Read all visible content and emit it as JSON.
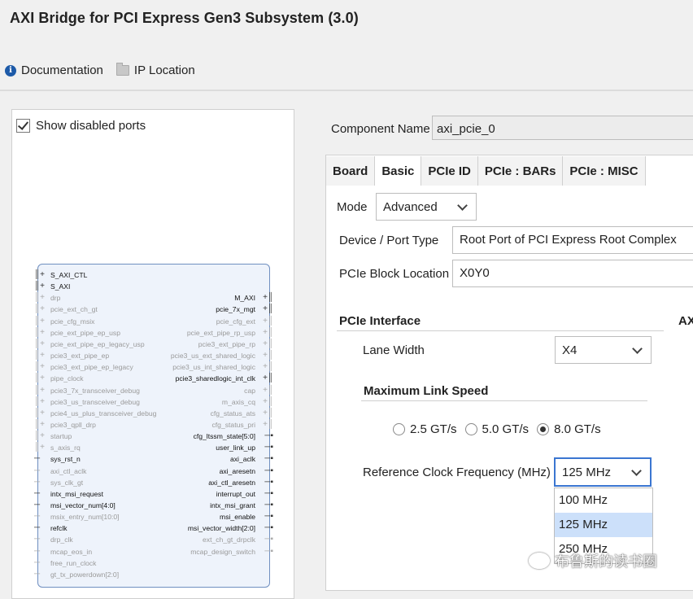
{
  "window": {
    "title": "AXI Bridge for PCI Express Gen3 Subsystem (3.0)"
  },
  "toolbar": {
    "documentation": "Documentation",
    "ip_location": "IP Location"
  },
  "left": {
    "show_disabled_ports": "Show disabled ports"
  },
  "block": {
    "left_ports": [
      {
        "label": "S_AXI_CTL",
        "enabled": true,
        "pin": "+"
      },
      {
        "label": "S_AXI",
        "enabled": true,
        "pin": "+"
      },
      {
        "label": "drp",
        "enabled": false,
        "pin": "+"
      },
      {
        "label": "pcie_ext_ch_gt",
        "enabled": false,
        "pin": "+"
      },
      {
        "label": "pcie_cfg_msix",
        "enabled": false,
        "pin": "+"
      },
      {
        "label": "pcie_ext_pipe_ep_usp",
        "enabled": false,
        "pin": "+"
      },
      {
        "label": "pcie_ext_pipe_ep_legacy_usp",
        "enabled": false,
        "pin": "+"
      },
      {
        "label": "pcie3_ext_pipe_ep",
        "enabled": false,
        "pin": "+"
      },
      {
        "label": "pcie3_ext_pipe_ep_legacy",
        "enabled": false,
        "pin": "+"
      },
      {
        "label": "pipe_clock",
        "enabled": false,
        "pin": "+"
      },
      {
        "label": "pcie3_7x_transceiver_debug",
        "enabled": false,
        "pin": "+"
      },
      {
        "label": "pcie3_us_transceiver_debug",
        "enabled": false,
        "pin": "+"
      },
      {
        "label": "pcie4_us_plus_transceiver_debug",
        "enabled": false,
        "pin": "+"
      },
      {
        "label": "pcie3_qpll_drp",
        "enabled": false,
        "pin": "+"
      },
      {
        "label": "startup",
        "enabled": false,
        "pin": "+"
      },
      {
        "label": "s_axis_rq",
        "enabled": false,
        "pin": "+"
      },
      {
        "label": "sys_rst_n",
        "enabled": true,
        "pin": "-"
      },
      {
        "label": "axi_ctl_aclk",
        "enabled": false,
        "pin": "-"
      },
      {
        "label": "sys_clk_gt",
        "enabled": false,
        "pin": "-"
      },
      {
        "label": "intx_msi_request",
        "enabled": true,
        "pin": "-"
      },
      {
        "label": "msi_vector_num[4:0]",
        "enabled": true,
        "pin": "-"
      },
      {
        "label": "msix_entry_num[10:0]",
        "enabled": false,
        "pin": "-"
      },
      {
        "label": "refclk",
        "enabled": true,
        "pin": "-"
      },
      {
        "label": "drp_clk",
        "enabled": false,
        "pin": "-"
      },
      {
        "label": "mcap_eos_in",
        "enabled": false,
        "pin": "-"
      },
      {
        "label": "free_run_clock",
        "enabled": false,
        "pin": "-"
      },
      {
        "label": "gt_tx_powerdown[2:0]",
        "enabled": false,
        "pin": "-"
      }
    ],
    "right_ports": [
      {
        "label": "",
        "enabled": false,
        "pin": ""
      },
      {
        "label": "",
        "enabled": false,
        "pin": ""
      },
      {
        "label": "M_AXI",
        "enabled": true,
        "pin": "+"
      },
      {
        "label": "pcie_7x_mgt",
        "enabled": true,
        "pin": "+"
      },
      {
        "label": "pcie_cfg_ext",
        "enabled": false,
        "pin": "+"
      },
      {
        "label": "pcie_ext_pipe_rp_usp",
        "enabled": false,
        "pin": "+"
      },
      {
        "label": "pcie3_ext_pipe_rp",
        "enabled": false,
        "pin": "+"
      },
      {
        "label": "pcie3_us_ext_shared_logic",
        "enabled": false,
        "pin": "+"
      },
      {
        "label": "pcie3_us_int_shared_logic",
        "enabled": false,
        "pin": "+"
      },
      {
        "label": "pcie3_sharedlogic_int_clk",
        "enabled": true,
        "pin": "+"
      },
      {
        "label": "cap",
        "enabled": false,
        "pin": "+"
      },
      {
        "label": "m_axis_cq",
        "enabled": false,
        "pin": "+"
      },
      {
        "label": "cfg_status_ats",
        "enabled": false,
        "pin": "+"
      },
      {
        "label": "cfg_status_pri",
        "enabled": false,
        "pin": "+"
      },
      {
        "label": "cfg_ltssm_state[5:0]",
        "enabled": true,
        "pin": "-"
      },
      {
        "label": "user_link_up",
        "enabled": true,
        "pin": "-"
      },
      {
        "label": "axi_aclk",
        "enabled": true,
        "pin": "-"
      },
      {
        "label": "axi_aresetn",
        "enabled": true,
        "pin": "-"
      },
      {
        "label": "axi_ctl_aresetn",
        "enabled": true,
        "pin": "-"
      },
      {
        "label": "interrupt_out",
        "enabled": true,
        "pin": "-"
      },
      {
        "label": "intx_msi_grant",
        "enabled": true,
        "pin": "-"
      },
      {
        "label": "msi_enable",
        "enabled": true,
        "pin": "-"
      },
      {
        "label": "msi_vector_width[2:0]",
        "enabled": true,
        "pin": "-"
      },
      {
        "label": "ext_ch_gt_drpclk",
        "enabled": false,
        "pin": "-"
      },
      {
        "label": "mcap_design_switch",
        "enabled": false,
        "pin": "-"
      }
    ]
  },
  "config": {
    "component_name_label": "Component Name",
    "component_name_value": "axi_pcie_0",
    "tabs": [
      "Board",
      "Basic",
      "PCIe ID",
      "PCIe : BARs",
      "PCIe : MISC"
    ],
    "active_tab": "Basic",
    "mode_label": "Mode",
    "mode_value": "Advanced",
    "device_port_type_label": "Device / Port Type",
    "device_port_type_value": "Root Port of PCI Express Root Complex",
    "pcie_block_location_label": "PCIe Block Location",
    "pcie_block_location_value": "X0Y0",
    "pcie_interface_header": "PCIe Interface",
    "axi_header_partial": "AX",
    "lane_width_label": "Lane Width",
    "lane_width_value": "X4",
    "max_link_speed_header": "Maximum Link Speed",
    "link_speeds": [
      {
        "label": "2.5 GT/s",
        "selected": false
      },
      {
        "label": "5.0 GT/s",
        "selected": false
      },
      {
        "label": "8.0 GT/s",
        "selected": true
      }
    ],
    "ref_clock_label": "Reference Clock Frequency (MHz)",
    "ref_clock_value": "125 MHz",
    "ref_clock_options": [
      "100 MHz",
      "125 MHz",
      "250 MHz"
    ],
    "ref_clock_highlighted": "125 MHz"
  },
  "watermark": "布鲁斯的读书圈",
  "colors": {
    "accent": "#3b76d1",
    "highlight": "#cce0fa",
    "block_fill": "#eef3fb",
    "block_border": "#6f8fc0"
  }
}
